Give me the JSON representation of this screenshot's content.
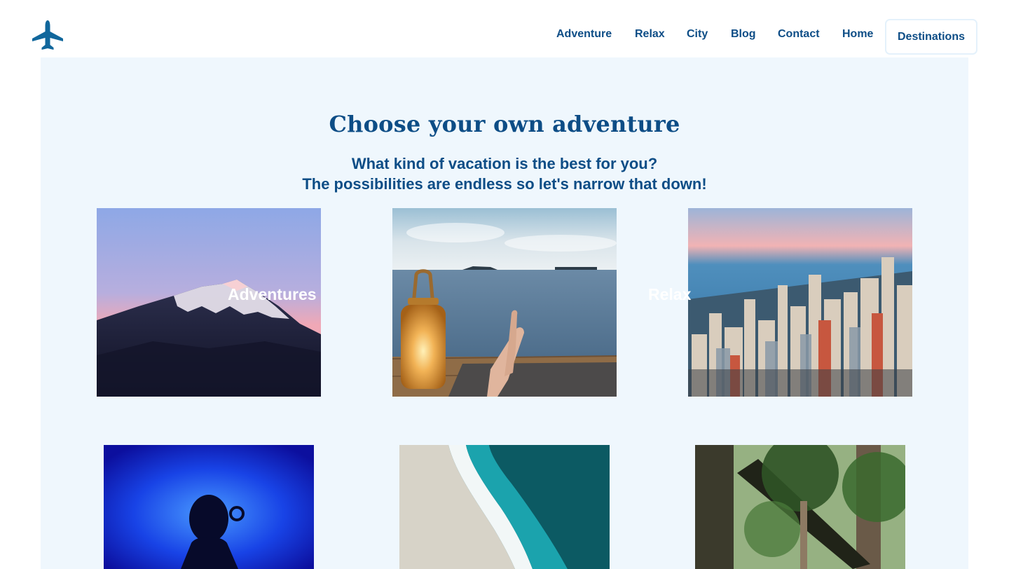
{
  "header": {
    "logo_icon": "airplane-icon",
    "nav": {
      "adventure": "Adventure",
      "relax": "Relax",
      "city": "City",
      "blog": "Blog",
      "contact": "Contact",
      "home": "Home",
      "destinations": "Destinations"
    }
  },
  "main": {
    "title": "Choose your own adventure",
    "subtitle_line1": "What kind of vacation is the best for you?",
    "subtitle_line2": "The possibilities are endless so let's narrow that down!",
    "labels": {
      "adventures": "Adventures",
      "relax": "Relax"
    },
    "images": [
      "mountain-photo",
      "lake-dock-photo",
      "city-skyline-photo",
      "scuba-diver-photo",
      "beach-aerial-photo",
      "forest-photo"
    ]
  },
  "colors": {
    "brand": "#0d4d86",
    "logo": "#11679c",
    "section_bg": "#eff7fd",
    "button_border": "#e4f1fb"
  }
}
